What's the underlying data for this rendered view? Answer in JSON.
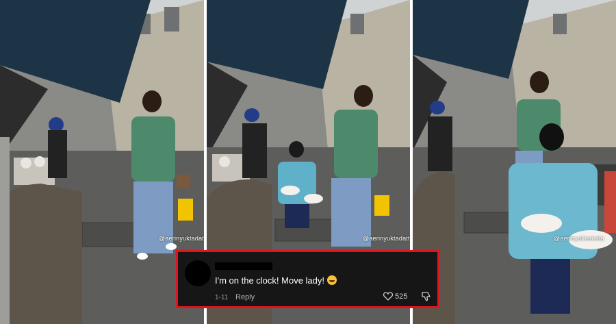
{
  "watermark": "@aerinyuktadatta",
  "comment": {
    "text": "I'm on the clock! Move lady!",
    "emoji": "laughing-crying-face",
    "date": "1-11",
    "reply_label": "Reply",
    "like_count": "525",
    "border_color": "#e0131f",
    "background_color": "#161616"
  }
}
